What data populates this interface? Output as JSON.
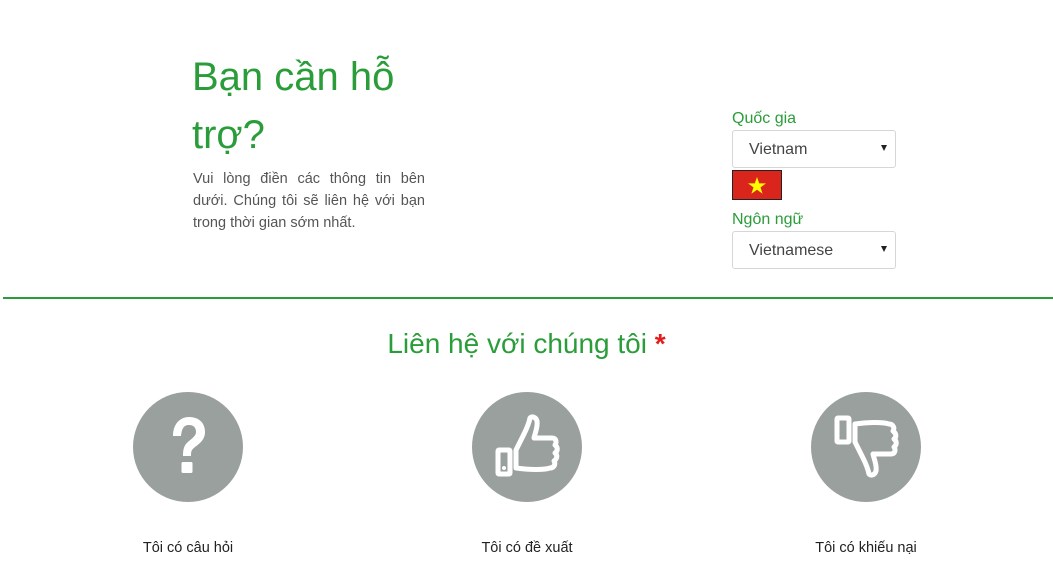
{
  "hero": {
    "title": "Bạn cần hỗ trợ?",
    "description": "Vui lòng điền các thông tin bên dưới. Chúng tôi sẽ liên hệ với bạn trong thời gian sớm nhất."
  },
  "country": {
    "label": "Quốc gia",
    "selected": "Vietnam",
    "flag_icon": "vietnam-flag-icon",
    "flag_colors": {
      "background": "#da251d",
      "star": "#ffff00"
    }
  },
  "language": {
    "label": "Ngôn ngữ",
    "selected": "Vietnamese"
  },
  "contact": {
    "title": "Liên hệ với chúng tôi",
    "required_mark": "*",
    "options": [
      {
        "label": "Tôi có câu hỏi",
        "icon": "question-mark-icon"
      },
      {
        "label": "Tôi có đề xuất",
        "icon": "thumbs-up-icon"
      },
      {
        "label": "Tôi có khiếu nại",
        "icon": "thumbs-down-icon"
      }
    ]
  },
  "colors": {
    "accent": "#2a9d3a",
    "required": "#e21b1b",
    "icon_circle": "#9aa09e"
  }
}
